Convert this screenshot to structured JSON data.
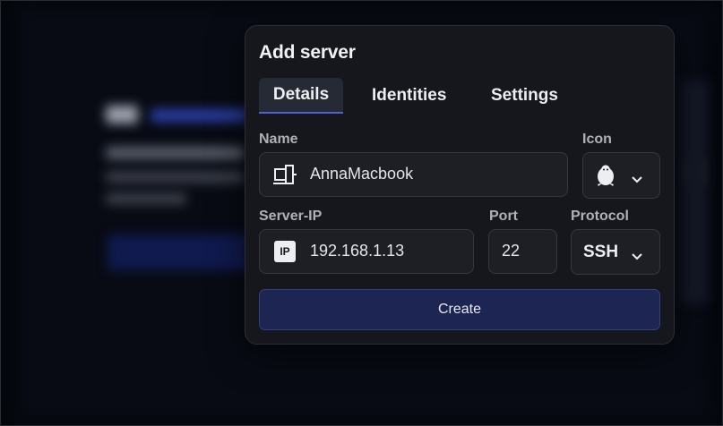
{
  "dialog": {
    "title": "Add server",
    "tabs": [
      {
        "label": "Details",
        "active": true
      },
      {
        "label": "Identities",
        "active": false
      },
      {
        "label": "Settings",
        "active": false
      }
    ],
    "name": {
      "label": "Name",
      "value": "AnnaMacbook",
      "icon": "desktop-computer-icon"
    },
    "icon_select": {
      "label": "Icon",
      "selected_icon": "linux-penguin-icon"
    },
    "server_ip": {
      "label": "Server-IP",
      "value": "192.168.1.13",
      "badge": "IP"
    },
    "port": {
      "label": "Port",
      "value": "22"
    },
    "protocol": {
      "label": "Protocol",
      "selected": "SSH"
    },
    "create_label": "Create"
  },
  "colors": {
    "accent": "#4b61d4",
    "button_bg": "#1d2552",
    "dialog_bg": "#15171c"
  }
}
